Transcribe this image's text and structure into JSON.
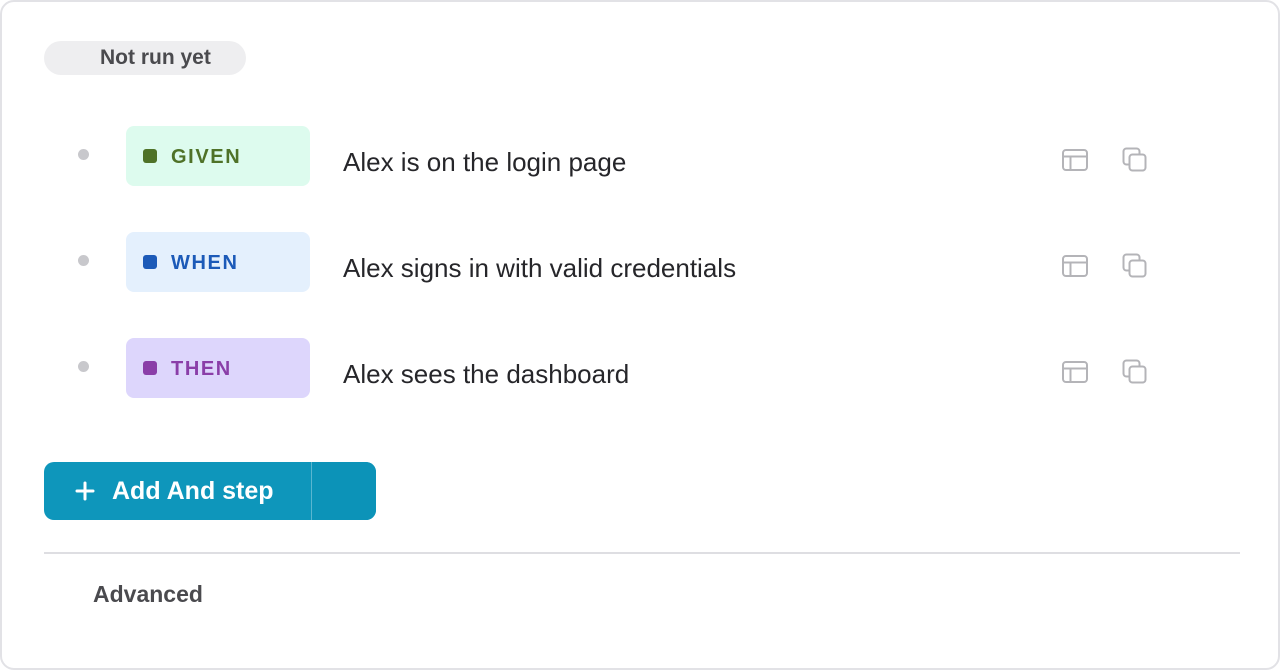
{
  "status": {
    "label": "Not run yet"
  },
  "steps": [
    {
      "keyword": "GIVEN",
      "text": "Alex is on the login page",
      "colors": {
        "chip_bg": "#ddfbee",
        "accent": "#4f7228"
      }
    },
    {
      "keyword": "WHEN",
      "text": "Alex signs in with valid credentials",
      "colors": {
        "chip_bg": "#e4f0fd",
        "accent": "#1c5ab8"
      }
    },
    {
      "keyword": "THEN",
      "text": "Alex sees the dashboard",
      "colors": {
        "chip_bg": "#ddd6fc",
        "accent": "#8a3ea8"
      }
    }
  ],
  "step_icons": [
    "layout-panel-icon",
    "duplicate-icon"
  ],
  "add_step": {
    "label": "Add And step",
    "icon": "plus-icon",
    "dropdown_icon": "chevron-down-icon"
  },
  "advanced": {
    "label": "Advanced"
  },
  "theme": {
    "primary": "#0e96bb",
    "icon_gray": "#b4b4b8",
    "text": "#26262a",
    "muted_text": "#4a4a4e"
  }
}
